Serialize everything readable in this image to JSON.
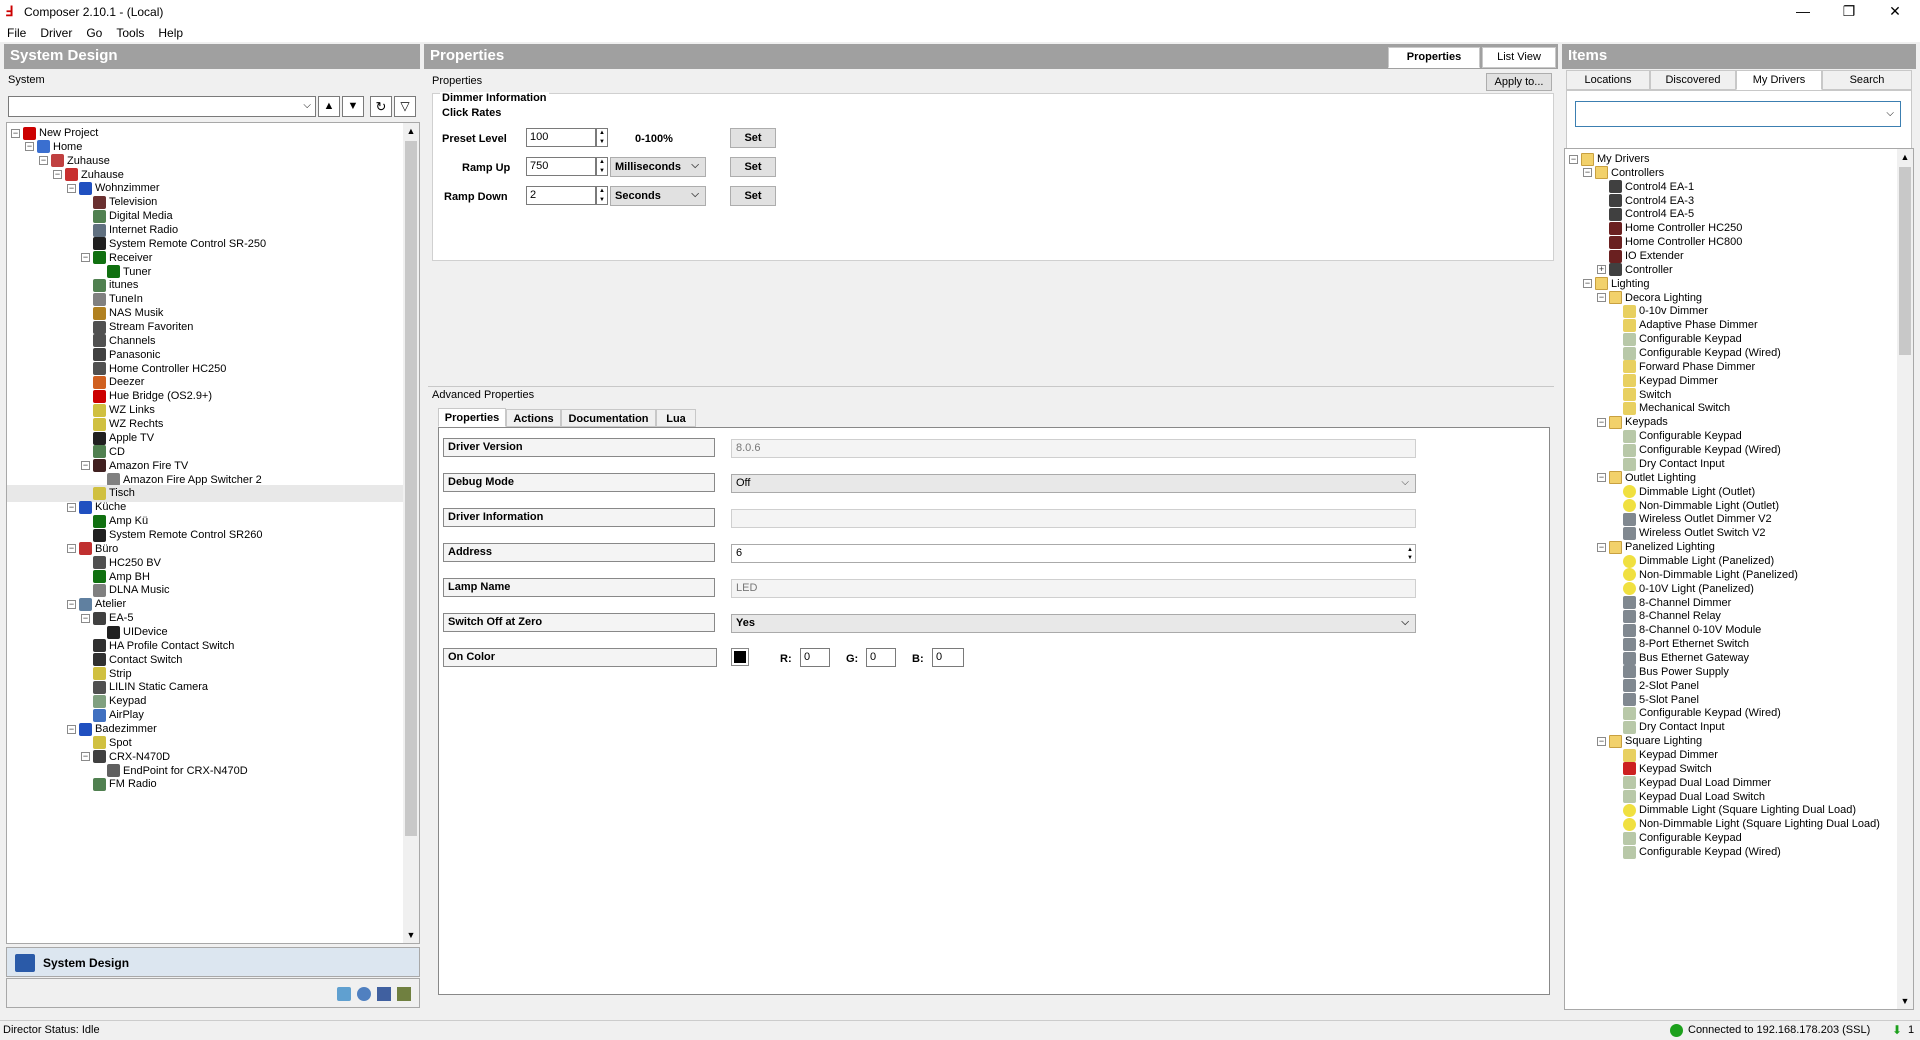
{
  "app": {
    "title": "Composer 2.10.1 - (Local)"
  },
  "menu": [
    "File",
    "Driver",
    "Go",
    "Tools",
    "Help"
  ],
  "system_design": {
    "header": "System Design",
    "sublabel": "System",
    "footer_label": "System Design",
    "tree": [
      {
        "depth": 0,
        "label": "New Project",
        "exp": "-",
        "color": "#cc0000"
      },
      {
        "depth": 1,
        "label": "Home",
        "exp": "-",
        "color": "#3a6fd0"
      },
      {
        "depth": 2,
        "label": "Zuhause",
        "exp": "-",
        "color": "#c04040"
      },
      {
        "depth": 3,
        "label": "Zuhause",
        "exp": "-",
        "color": "#c83030"
      },
      {
        "depth": 4,
        "label": "Wohnzimmer",
        "exp": "-",
        "color": "#2050c0"
      },
      {
        "depth": 5,
        "label": "Television",
        "exp": "",
        "color": "#6a3030"
      },
      {
        "depth": 5,
        "label": "Digital Media",
        "exp": "",
        "color": "#508050"
      },
      {
        "depth": 5,
        "label": "Internet Radio",
        "exp": "",
        "color": "#607080"
      },
      {
        "depth": 5,
        "label": "System Remote Control SR-250",
        "exp": "",
        "color": "#202020"
      },
      {
        "depth": 5,
        "label": "Receiver",
        "exp": "-",
        "color": "#107010"
      },
      {
        "depth": 6,
        "label": "Tuner",
        "exp": "",
        "color": "#107010"
      },
      {
        "depth": 5,
        "label": "itunes",
        "exp": "",
        "color": "#508050"
      },
      {
        "depth": 5,
        "label": "TuneIn",
        "exp": "",
        "color": "#808080"
      },
      {
        "depth": 5,
        "label": "NAS Musik",
        "exp": "",
        "color": "#b08020"
      },
      {
        "depth": 5,
        "label": "Stream Favoriten",
        "exp": "",
        "color": "#505050"
      },
      {
        "depth": 5,
        "label": "Channels",
        "exp": "",
        "color": "#505050"
      },
      {
        "depth": 5,
        "label": "Panasonic",
        "exp": "",
        "color": "#404040"
      },
      {
        "depth": 5,
        "label": "Home Controller HC250",
        "exp": "",
        "color": "#505050"
      },
      {
        "depth": 5,
        "label": "Deezer",
        "exp": "",
        "color": "#d06020"
      },
      {
        "depth": 5,
        "label": "Hue Bridge (OS2.9+)",
        "exp": "",
        "color": "#cc0000"
      },
      {
        "depth": 5,
        "label": "WZ Links",
        "exp": "",
        "color": "#d0c040"
      },
      {
        "depth": 5,
        "label": "WZ Rechts",
        "exp": "",
        "color": "#d0c040"
      },
      {
        "depth": 5,
        "label": "Apple TV",
        "exp": "",
        "color": "#202020"
      },
      {
        "depth": 5,
        "label": "CD",
        "exp": "",
        "color": "#508050"
      },
      {
        "depth": 5,
        "label": "Amazon Fire TV",
        "exp": "-",
        "color": "#402020"
      },
      {
        "depth": 6,
        "label": "Amazon Fire App Switcher 2",
        "exp": "",
        "color": "#808080"
      },
      {
        "depth": 5,
        "label": "Tisch",
        "exp": "",
        "color": "#d0c040",
        "selected": true
      },
      {
        "depth": 4,
        "label": "Küche",
        "exp": "-",
        "color": "#2050c0"
      },
      {
        "depth": 5,
        "label": "Amp Kü",
        "exp": "",
        "color": "#107010"
      },
      {
        "depth": 5,
        "label": "System Remote Control SR260",
        "exp": "",
        "color": "#202020"
      },
      {
        "depth": 4,
        "label": "Büro",
        "exp": "-",
        "color": "#c03030"
      },
      {
        "depth": 5,
        "label": "HC250 BV",
        "exp": "",
        "color": "#505050"
      },
      {
        "depth": 5,
        "label": "Amp BH",
        "exp": "",
        "color": "#107010"
      },
      {
        "depth": 5,
        "label": "DLNA Music",
        "exp": "",
        "color": "#808080"
      },
      {
        "depth": 4,
        "label": "Atelier",
        "exp": "-",
        "color": "#6080a0"
      },
      {
        "depth": 5,
        "label": "EA-5",
        "exp": "-",
        "color": "#404040"
      },
      {
        "depth": 6,
        "label": "UIDevice",
        "exp": "",
        "color": "#202020"
      },
      {
        "depth": 5,
        "label": "HA Profile Contact Switch",
        "exp": "",
        "color": "#303030"
      },
      {
        "depth": 5,
        "label": "Contact Switch",
        "exp": "",
        "color": "#303030"
      },
      {
        "depth": 5,
        "label": "Strip",
        "exp": "",
        "color": "#d0c040"
      },
      {
        "depth": 5,
        "label": "LILIN Static Camera",
        "exp": "",
        "color": "#505050"
      },
      {
        "depth": 5,
        "label": "Keypad",
        "exp": "",
        "color": "#80a080"
      },
      {
        "depth": 5,
        "label": "AirPlay",
        "exp": "",
        "color": "#4070c0"
      },
      {
        "depth": 4,
        "label": "Badezimmer",
        "exp": "-",
        "color": "#2050c0"
      },
      {
        "depth": 5,
        "label": "Spot",
        "exp": "",
        "color": "#d0c040"
      },
      {
        "depth": 5,
        "label": "CRX-N470D",
        "exp": "-",
        "color": "#404040"
      },
      {
        "depth": 6,
        "label": "EndPoint for CRX-N470D",
        "exp": "",
        "color": "#606060"
      },
      {
        "depth": 5,
        "label": "FM Radio",
        "exp": "",
        "color": "#508050"
      }
    ]
  },
  "properties": {
    "header": "Properties",
    "tab_properties": "Properties",
    "tab_listview": "List View",
    "section_label": "Properties",
    "apply_btn": "Apply to...",
    "group_dimmer": "Dimmer Information",
    "group_click": "Click Rates",
    "preset_label": "Preset Level",
    "preset_value": "100",
    "preset_range": "0-100%",
    "rampup_label": "Ramp Up",
    "rampup_value": "750",
    "rampup_unit": "Milliseconds",
    "rampdown_label": "Ramp Down",
    "rampdown_value": "2",
    "rampdown_unit": "Seconds",
    "set_label": "Set",
    "advanced_label": "Advanced Properties",
    "adv_tabs": [
      "Properties",
      "Actions",
      "Documentation",
      "Lua"
    ],
    "rows": {
      "driver_version": {
        "label": "Driver Version",
        "value": "8.0.6"
      },
      "debug_mode": {
        "label": "Debug Mode",
        "value": "Off"
      },
      "driver_info": {
        "label": "Driver Information",
        "value": ""
      },
      "address": {
        "label": "Address",
        "value": "6"
      },
      "lamp_name": {
        "label": "Lamp Name",
        "value": "LED"
      },
      "switch_off": {
        "label": "Switch Off at Zero",
        "value": "Yes"
      },
      "on_color": {
        "label": "On Color",
        "r_label": "R:",
        "r": "0",
        "g_label": "G:",
        "g": "0",
        "b_label": "B:",
        "b": "0"
      }
    }
  },
  "items": {
    "header": "Items",
    "tabs": [
      "Locations",
      "Discovered",
      "My Drivers",
      "Search"
    ],
    "tree": [
      {
        "depth": 0,
        "label": "My Drivers",
        "exp": "-",
        "kind": "folder"
      },
      {
        "depth": 1,
        "label": "Controllers",
        "exp": "-",
        "kind": "folder"
      },
      {
        "depth": 2,
        "label": "Control4 EA-1",
        "exp": "",
        "kind": "dev"
      },
      {
        "depth": 2,
        "label": "Control4 EA-3",
        "exp": "",
        "kind": "dev"
      },
      {
        "depth": 2,
        "label": "Control4 EA-5",
        "exp": "",
        "kind": "dev"
      },
      {
        "depth": 2,
        "label": "Home Controller HC250",
        "exp": "",
        "kind": "hc"
      },
      {
        "depth": 2,
        "label": "Home Controller HC800",
        "exp": "",
        "kind": "hc"
      },
      {
        "depth": 2,
        "label": "IO Extender",
        "exp": "",
        "kind": "hc"
      },
      {
        "depth": 2,
        "label": "Controller",
        "exp": "+",
        "kind": "dev"
      },
      {
        "depth": 1,
        "label": "Lighting",
        "exp": "-",
        "kind": "folder"
      },
      {
        "depth": 2,
        "label": "Decora Lighting",
        "exp": "-",
        "kind": "folder"
      },
      {
        "depth": 3,
        "label": "0-10v Dimmer",
        "exp": "",
        "kind": "sw"
      },
      {
        "depth": 3,
        "label": "Adaptive Phase Dimmer",
        "exp": "",
        "kind": "sw"
      },
      {
        "depth": 3,
        "label": "Configurable Keypad",
        "exp": "",
        "kind": "kp"
      },
      {
        "depth": 3,
        "label": "Configurable Keypad (Wired)",
        "exp": "",
        "kind": "kp"
      },
      {
        "depth": 3,
        "label": "Forward Phase Dimmer",
        "exp": "",
        "kind": "sw"
      },
      {
        "depth": 3,
        "label": "Keypad Dimmer",
        "exp": "",
        "kind": "sw"
      },
      {
        "depth": 3,
        "label": "Switch",
        "exp": "",
        "kind": "sw"
      },
      {
        "depth": 3,
        "label": "Mechanical Switch",
        "exp": "",
        "kind": "sw"
      },
      {
        "depth": 2,
        "label": "Keypads",
        "exp": "-",
        "kind": "folder"
      },
      {
        "depth": 3,
        "label": "Configurable Keypad",
        "exp": "",
        "kind": "kp"
      },
      {
        "depth": 3,
        "label": "Configurable Keypad (Wired)",
        "exp": "",
        "kind": "kp"
      },
      {
        "depth": 3,
        "label": "Dry Contact Input",
        "exp": "",
        "kind": "kp"
      },
      {
        "depth": 2,
        "label": "Outlet Lighting",
        "exp": "-",
        "kind": "folder"
      },
      {
        "depth": 3,
        "label": "Dimmable Light (Outlet)",
        "exp": "",
        "kind": "bulb"
      },
      {
        "depth": 3,
        "label": "Non-Dimmable Light (Outlet)",
        "exp": "",
        "kind": "bulb"
      },
      {
        "depth": 3,
        "label": "Wireless Outlet Dimmer V2",
        "exp": "",
        "kind": "wl"
      },
      {
        "depth": 3,
        "label": "Wireless Outlet Switch V2",
        "exp": "",
        "kind": "wl"
      },
      {
        "depth": 2,
        "label": "Panelized Lighting",
        "exp": "-",
        "kind": "folder"
      },
      {
        "depth": 3,
        "label": "Dimmable Light (Panelized)",
        "exp": "",
        "kind": "bulb"
      },
      {
        "depth": 3,
        "label": "Non-Dimmable Light (Panelized)",
        "exp": "",
        "kind": "bulb"
      },
      {
        "depth": 3,
        "label": "0-10V Light (Panelized)",
        "exp": "",
        "kind": "bulb"
      },
      {
        "depth": 3,
        "label": "8-Channel Dimmer",
        "exp": "",
        "kind": "wl"
      },
      {
        "depth": 3,
        "label": "8-Channel Relay",
        "exp": "",
        "kind": "wl"
      },
      {
        "depth": 3,
        "label": "8-Channel 0-10V Module",
        "exp": "",
        "kind": "wl"
      },
      {
        "depth": 3,
        "label": "8-Port Ethernet Switch",
        "exp": "",
        "kind": "wl"
      },
      {
        "depth": 3,
        "label": "Bus Ethernet Gateway",
        "exp": "",
        "kind": "wl"
      },
      {
        "depth": 3,
        "label": "Bus Power Supply",
        "exp": "",
        "kind": "wl"
      },
      {
        "depth": 3,
        "label": "2-Slot Panel",
        "exp": "",
        "kind": "wl"
      },
      {
        "depth": 3,
        "label": "5-Slot Panel",
        "exp": "",
        "kind": "wl"
      },
      {
        "depth": 3,
        "label": "Configurable Keypad (Wired)",
        "exp": "",
        "kind": "kp"
      },
      {
        "depth": 3,
        "label": "Dry Contact Input",
        "exp": "",
        "kind": "kp"
      },
      {
        "depth": 2,
        "label": "Square Lighting",
        "exp": "-",
        "kind": "folder"
      },
      {
        "depth": 3,
        "label": "Keypad Dimmer",
        "exp": "",
        "kind": "sw"
      },
      {
        "depth": 3,
        "label": "Keypad Switch",
        "exp": "",
        "kind": "c4"
      },
      {
        "depth": 3,
        "label": "Keypad Dual Load Dimmer",
        "exp": "",
        "kind": "kp"
      },
      {
        "depth": 3,
        "label": "Keypad Dual Load Switch",
        "exp": "",
        "kind": "kp"
      },
      {
        "depth": 3,
        "label": "Dimmable Light (Square Lighting Dual Load)",
        "exp": "",
        "kind": "bulb"
      },
      {
        "depth": 3,
        "label": "Non-Dimmable Light (Square Lighting Dual Load)",
        "exp": "",
        "kind": "bulb"
      },
      {
        "depth": 3,
        "label": "Configurable Keypad",
        "exp": "",
        "kind": "kp"
      },
      {
        "depth": 3,
        "label": "Configurable Keypad (Wired)",
        "exp": "",
        "kind": "kp"
      }
    ]
  },
  "status": {
    "left": "Director Status: Idle",
    "right": "Connected to 192.168.178.203 (SSL)",
    "count": "1"
  }
}
